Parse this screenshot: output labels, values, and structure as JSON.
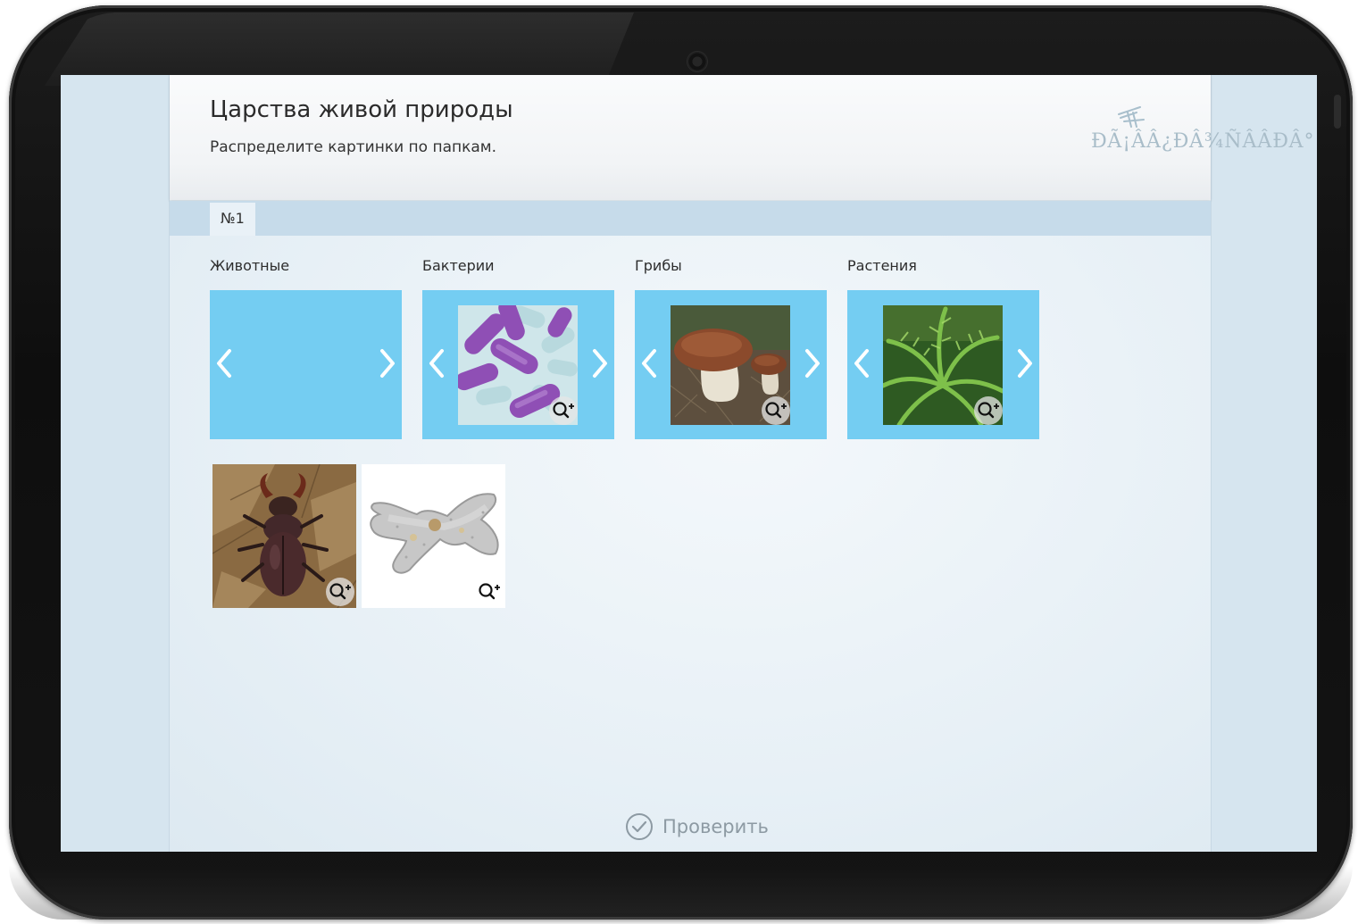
{
  "app": {
    "title": "Царства живой природы",
    "instruction": "Распределите картинки по папкам.",
    "logo_text": "ÐÃ¡ÂÂ¿ÐÂ¾ÑÂÂÐÂ°"
  },
  "tabs": [
    {
      "label": "№1",
      "selected": true
    }
  ],
  "categories": [
    {
      "label": "Животные",
      "image": "empty"
    },
    {
      "label": "Бактерии",
      "image": "bacteria-photo"
    },
    {
      "label": "Грибы",
      "image": "mushroom-photo"
    },
    {
      "label": "Растения",
      "image": "fern-photo"
    }
  ],
  "cards": [
    {
      "image": "stag-beetle-photo"
    },
    {
      "image": "amoeba-photo"
    }
  ],
  "check_button": {
    "label": "Проверить",
    "icon": "check-circle-icon"
  },
  "colors": {
    "folder": "#74cdf2",
    "tabbar": "#c6dbea",
    "screen_bg": "#d6e5ef"
  }
}
